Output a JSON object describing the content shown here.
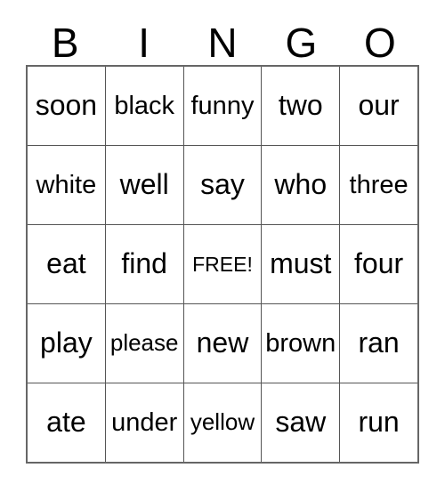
{
  "card": {
    "headers": [
      "B",
      "I",
      "N",
      "G",
      "O"
    ],
    "rows": [
      [
        "soon",
        "black",
        "funny",
        "two",
        "our"
      ],
      [
        "white",
        "well",
        "say",
        "who",
        "three"
      ],
      [
        "eat",
        "find",
        "FREE!",
        "must",
        "four"
      ],
      [
        "play",
        "please",
        "new",
        "brown",
        "ran"
      ],
      [
        "ate",
        "under",
        "yellow",
        "saw",
        "run"
      ]
    ],
    "free_space": "FREE!",
    "colors": {
      "background": "#ffffff",
      "text": "#000000",
      "grid_line": "#555555",
      "grid_border": "#666666"
    }
  }
}
